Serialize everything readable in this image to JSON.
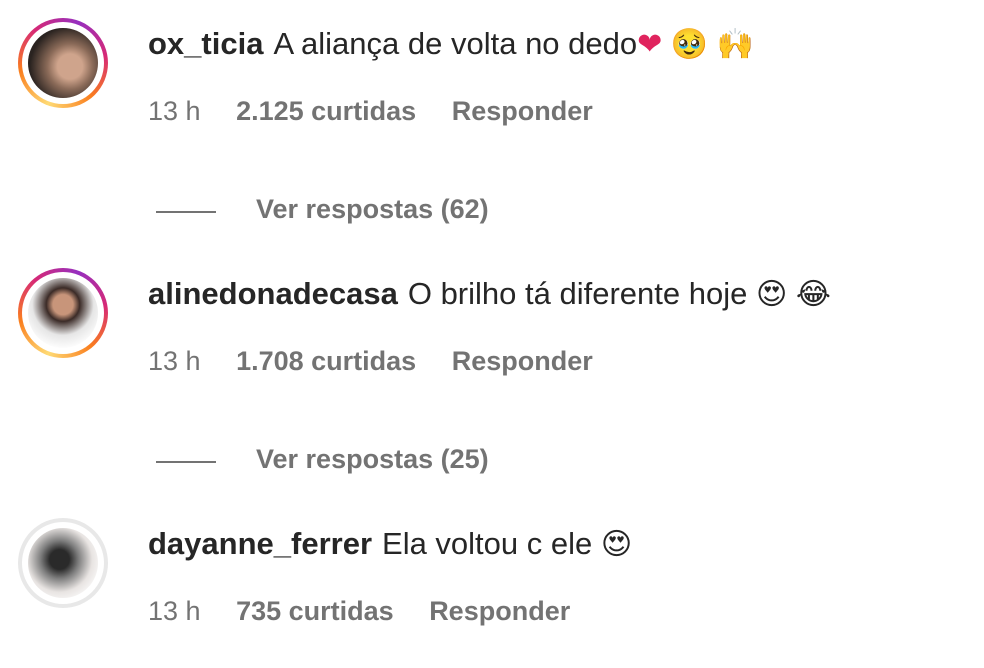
{
  "comments": [
    {
      "username": "ox_ticia",
      "text": "A aliança de volta no dedo",
      "emojis": [
        "❤",
        "🥹",
        "🙌"
      ],
      "time": "13 h",
      "likes": "2.125 curtidas",
      "reply": "Responder",
      "view_replies": "Ver respostas (62)",
      "has_story_ring": true
    },
    {
      "username": "alinedonadecasa",
      "text": "O brilho tá diferente hoje",
      "emojis": [
        "😍",
        "😂"
      ],
      "time": "13 h",
      "likes": "1.708 curtidas",
      "reply": "Responder",
      "view_replies": "Ver respostas (25)",
      "has_story_ring": true
    },
    {
      "username": "dayanne_ferrer",
      "text": "Ela voltou c ele",
      "emojis": [
        "😍"
      ],
      "time": "13 h",
      "likes": "735 curtidas",
      "reply": "Responder",
      "has_story_ring": false
    }
  ],
  "colors": {
    "text": "#262626",
    "secondary": "#737373",
    "heart": "#e0245e"
  }
}
